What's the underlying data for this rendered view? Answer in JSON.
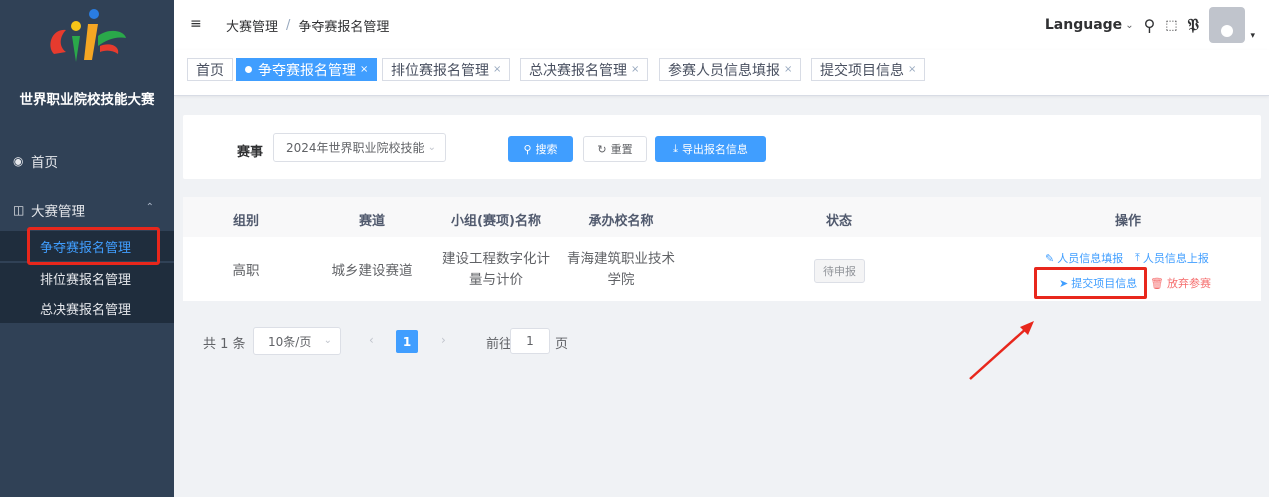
{
  "sidebar": {
    "brand": "世界职业院校技能大赛",
    "home": "首页",
    "group": "大赛管理",
    "sub_items": [
      {
        "label": "争夺赛报名管理",
        "active": true
      },
      {
        "label": "排位赛报名管理",
        "active": false
      },
      {
        "label": "总决赛报名管理",
        "active": false
      }
    ]
  },
  "header": {
    "breadcrumb": [
      "大赛管理",
      "争夺赛报名管理"
    ],
    "language": "Language"
  },
  "tags": [
    {
      "label": "首页",
      "closable": false,
      "active": false
    },
    {
      "label": "争夺赛报名管理",
      "closable": true,
      "active": true
    },
    {
      "label": "排位赛报名管理",
      "closable": true,
      "active": false
    },
    {
      "label": "总决赛报名管理",
      "closable": true,
      "active": false
    },
    {
      "label": "参赛人员信息填报",
      "closable": true,
      "active": false
    },
    {
      "label": "提交项目信息",
      "closable": true,
      "active": false
    }
  ],
  "search": {
    "event_label": "赛事",
    "event_value": "2024年世界职业院校技能",
    "search_btn": "搜索",
    "reset_btn": "重置",
    "export_btn": "导出报名信息"
  },
  "table": {
    "headers": [
      "组别",
      "赛道",
      "小组(赛项)名称",
      "承办校名称",
      "状态",
      "操作"
    ],
    "rows": [
      {
        "group": "高职",
        "track": "城乡建设赛道",
        "name_line1": "建设工程数字化计",
        "name_line2": "量与计价",
        "school_line1": "青海建筑职业技术",
        "school_line2": "学院",
        "status": "待申报",
        "ops": {
          "fill_info": "人员信息填报",
          "upload_info": "人员信息上报",
          "submit_project": "提交项目信息",
          "abandon": "放弃参赛"
        }
      }
    ]
  },
  "pagination": {
    "total": "共 1 条",
    "page_size": "10条/页",
    "current_page": "1",
    "goto_label": "前往",
    "goto_value": "1",
    "page_suffix": "页"
  },
  "colors": {
    "primary": "#409eff",
    "danger": "#f56c6c",
    "sidebar_bg": "#304156",
    "annotation": "#e8271c"
  }
}
